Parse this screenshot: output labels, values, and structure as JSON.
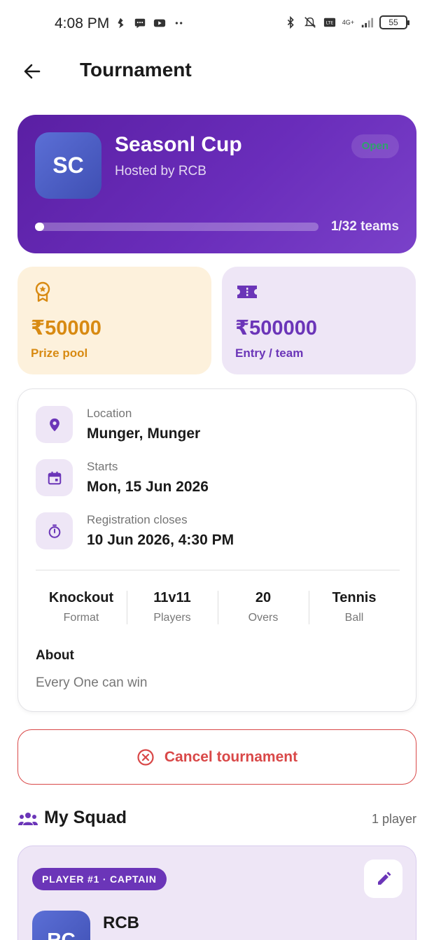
{
  "status_bar": {
    "time": "4:08 PM",
    "network": "4G+",
    "battery": "55"
  },
  "header": {
    "title": "Tournament"
  },
  "hero": {
    "avatar_initials": "SC",
    "title": "Seasonl Cup",
    "host": "Hosted by RCB",
    "status": "Open",
    "teams_text": "1/32 teams",
    "teams_joined": 1,
    "teams_total": 32,
    "colors": {
      "gradient_start": "#5a1fa3",
      "gradient_end": "#7a41c9",
      "status": "#2ea36b"
    }
  },
  "stats": {
    "prize": {
      "value": "₹50000",
      "label": "Prize pool",
      "icon": "award-icon",
      "color": "#d88a12"
    },
    "entry": {
      "value": "₹500000",
      "label": "Entry / team",
      "icon": "ticket-icon",
      "color": "#6b35b8"
    }
  },
  "details": {
    "location": {
      "label": "Location",
      "value": "Munger, Munger",
      "icon": "location-pin-icon"
    },
    "starts": {
      "label": "Starts",
      "value": "Mon, 15 Jun 2026",
      "icon": "calendar-icon"
    },
    "registration": {
      "label": "Registration closes",
      "value": "10 Jun 2026, 4:30 PM",
      "icon": "timer-icon"
    },
    "meta": [
      {
        "value": "Knockout",
        "label": "Format"
      },
      {
        "value": "11v11",
        "label": "Players"
      },
      {
        "value": "20",
        "label": "Overs"
      },
      {
        "value": "Tennis",
        "label": "Ball"
      }
    ],
    "about_title": "About",
    "about_text": "Every One can win"
  },
  "cancel": {
    "label": "Cancel tournament",
    "icon": "cancel-circle-icon",
    "color": "#d94848"
  },
  "squad": {
    "title": "My Squad",
    "count": "1 player",
    "player": {
      "badge": "PLAYER #1 · CAPTAIN",
      "avatar_initials": "RC",
      "name": "RCB"
    }
  }
}
